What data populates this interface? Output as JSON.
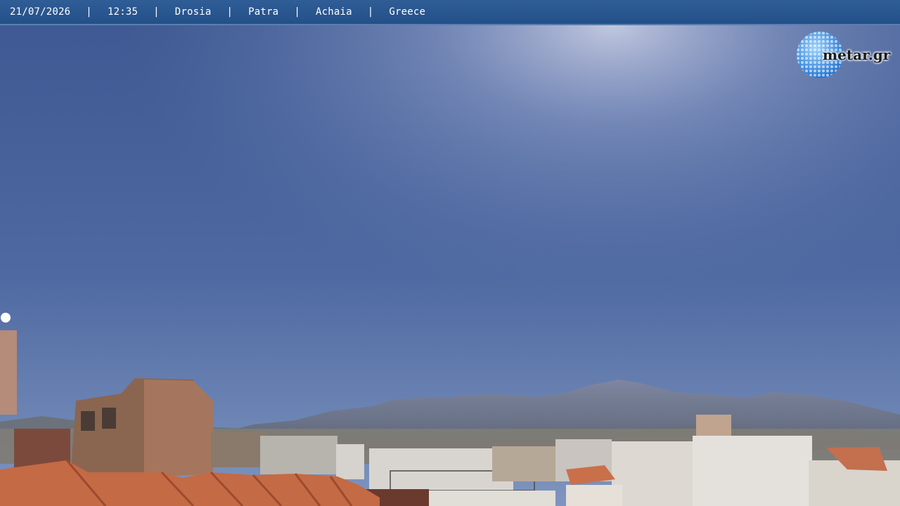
{
  "overlay": {
    "date": "21/07/2026",
    "time": "12:35",
    "area": "Drosia",
    "city": "Patra",
    "region": "Achaia",
    "country": "Greece",
    "separator": "|"
  },
  "logo": {
    "text": "metar.gr"
  },
  "colors": {
    "bar": "#2a5690",
    "sky_top": "#3d5892",
    "sky_glow": "#b9c3de",
    "roof_tiles": "#c46a45"
  }
}
